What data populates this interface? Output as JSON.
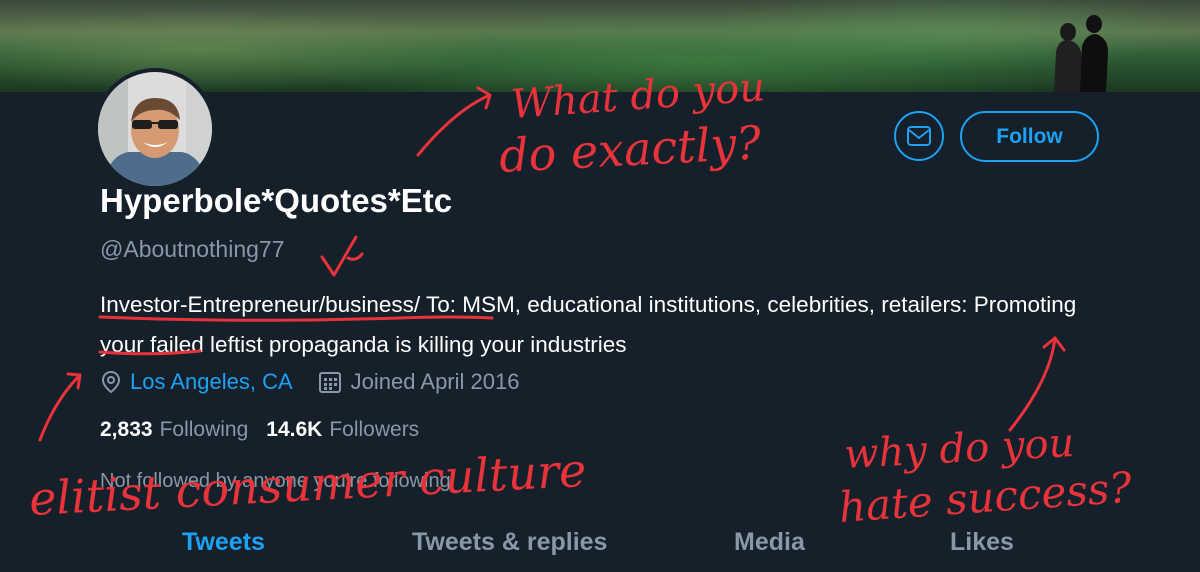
{
  "profile": {
    "name": "Hyperbole*Quotes*Etc",
    "handle": "@Aboutnothing77",
    "bio": "Investor-Entrepreneur/business/ To: MSM, educational institutions, celebrities, retailers: Promoting your failed leftist propaganda is killing your industries",
    "location": "Los Angeles, CA",
    "joined": "Joined April 2016",
    "following_count": "2,833",
    "following_label": "Following",
    "followers_count": "14.6K",
    "followers_label": "Followers",
    "not_followed": "Not followed by anyone you're following"
  },
  "actions": {
    "message_icon": "envelope-icon",
    "follow_label": "Follow"
  },
  "tabs": [
    {
      "label": "Tweets",
      "active": true
    },
    {
      "label": "Tweets & replies",
      "active": false
    },
    {
      "label": "Media",
      "active": false
    },
    {
      "label": "Likes",
      "active": false
    }
  ],
  "annotations": {
    "top": "What do you do exactly?",
    "left": "elitist consumer culture",
    "right": "why do you hate success?"
  },
  "colors": {
    "background": "#15202b",
    "accent": "#1da1f2",
    "muted": "#8899a6",
    "ink": "#e8333a"
  }
}
